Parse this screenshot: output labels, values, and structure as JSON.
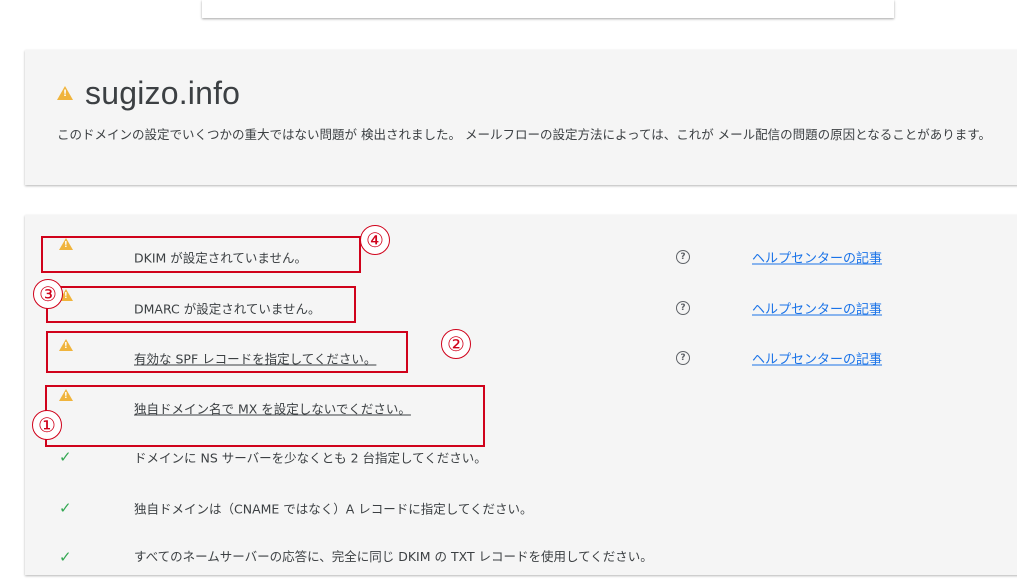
{
  "domain": {
    "name": "sugizo.info",
    "description": "このドメインの設定でいくつかの重大ではない問題が 検出されました。 メールフローの設定方法によっては、これが メール配信の問題の原因となることがあります。"
  },
  "icons": {
    "warning": "warning-triangle-icon",
    "ok": "check-icon",
    "help": "help-circle-icon"
  },
  "colors": {
    "warning": "#f0b43c",
    "ok": "#34a853",
    "link": "#1a73e8",
    "annotation": "#d0021b"
  },
  "checks": [
    {
      "status": "warning",
      "message": "DKIM が設定されていません。",
      "help_link": "ヘルプセンターの記事"
    },
    {
      "status": "warning",
      "message": "DMARC が設定されていません。",
      "help_link": "ヘルプセンターの記事"
    },
    {
      "status": "warning",
      "message": "有効な SPF レコードを指定してください。",
      "help_link": "ヘルプセンターの記事"
    },
    {
      "status": "warning",
      "message": "独自ドメイン名で MX を設定しないでください。"
    },
    {
      "status": "ok",
      "message": "ドメインに NS サーバーを少なくとも 2 台指定してください。"
    },
    {
      "status": "ok",
      "message": "独自ドメインは（CNAME ではなく）A レコードに指定してください。"
    },
    {
      "status": "ok",
      "message": "すべてのネームサーバーの応答に、完全に同じ DKIM の TXT レコードを使用してください。"
    }
  ],
  "annotations": [
    "④",
    "③",
    "②",
    "①"
  ]
}
